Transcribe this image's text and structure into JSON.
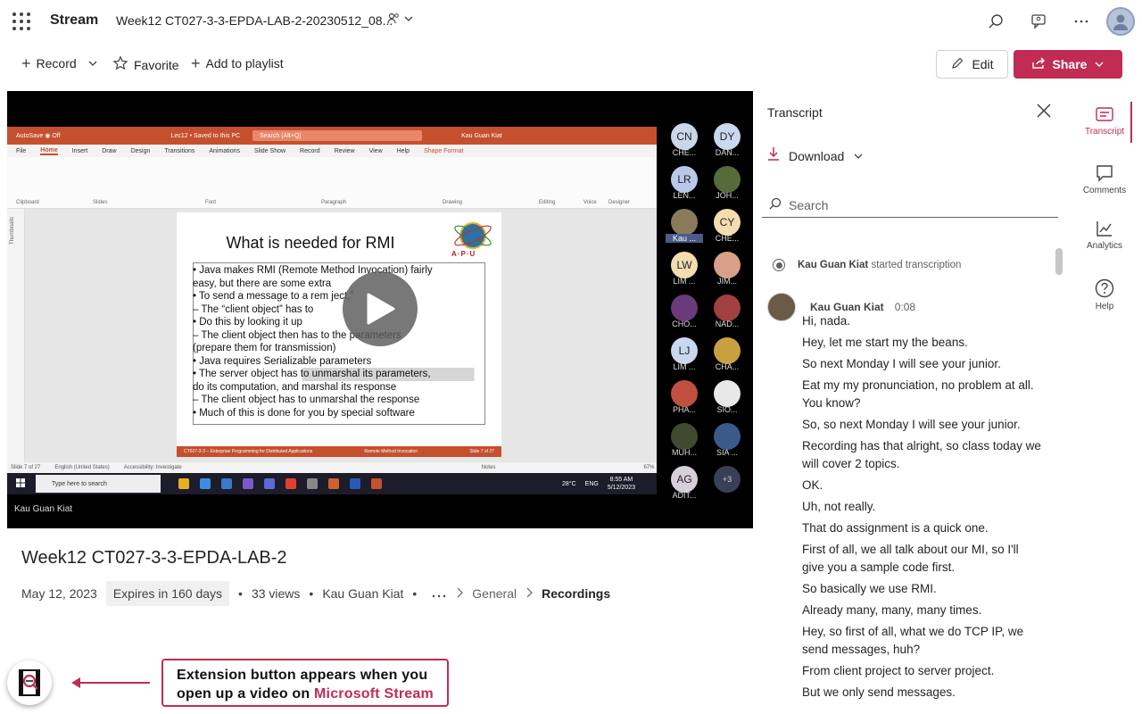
{
  "header": {
    "app_name": "Stream",
    "doc_title": "Week12 CT027-3-3-EPDA-LAB-2-20230512_08..."
  },
  "commands": {
    "record": "Record",
    "favorite": "Favorite",
    "add_to_playlist": "Add to playlist",
    "edit": "Edit",
    "share": "Share"
  },
  "video": {
    "presenter_name": "Kau Guan Kiat",
    "slide": {
      "title": "What is needed for RMI",
      "logo_text": "A·P·U",
      "lines": [
        "•  Java makes RMI (Remote Method Invocation) fairly",
        "    easy, but there are some extra",
        "•  To send a message to a rem              ject,”",
        "    –  The “client object” has to",
        "          •  Do this by looking it up",
        "    –  The client object then has to              the parameters",
        "        (prepare them for transmission)",
        "          •  Java requires Serializable parameters",
        "          •  The server object has to unmarshal its parameters,",
        "              do its computation, and marshal its response",
        "    –  The client object has to unmarshal the response",
        "•  Much of this is done for you by special software"
      ],
      "footer_left": "CT027-3-3 – Enterprise Programming for Distributed Applications",
      "footer_mid": "Remote Method Invocation",
      "footer_right": "Slide 7 of 27"
    },
    "powerpoint": {
      "title": "Lec12 • Saved to this PC",
      "search": "Search (Alt+Q)",
      "user": "Kau Guan Kiat",
      "tabs": [
        "File",
        "Home",
        "Insert",
        "Draw",
        "Design",
        "Transitions",
        "Animations",
        "Slide Show",
        "Record",
        "Review",
        "View",
        "Help",
        "Shape Format"
      ],
      "groups": [
        "Clipboard",
        "Slides",
        "Font",
        "Paragraph",
        "Drawing",
        "Editing",
        "Voice",
        "Designer"
      ],
      "status_slide": "Slide 7 of 27",
      "status_lang": "English (United States)",
      "status_access": "Accessibility: Investigate",
      "status_notes": "Notes",
      "status_zoom": "67%"
    },
    "taskbar": {
      "search": "Type here to search",
      "weather": "28°C",
      "lang": "ENG",
      "time": "8:55 AM",
      "date": "5/12/2023"
    },
    "participants": [
      {
        "initials": "CN",
        "name": "CHE...",
        "color": "#c8d8e8"
      },
      {
        "initials": "DY",
        "name": "DAN...",
        "color": "#c8d8ee"
      },
      {
        "initials": "LR",
        "name": "LEN...",
        "color": "#b8c8e8"
      },
      {
        "initials": "",
        "name": "JOH...",
        "color": "#556b3a"
      },
      {
        "initials": "",
        "name": "Kau ...",
        "color": "#8a7a5a"
      },
      {
        "initials": "CY",
        "name": "CHE...",
        "color": "#f2dcb0"
      },
      {
        "initials": "LW",
        "name": "LIM ...",
        "color": "#f2dcb0"
      },
      {
        "initials": "",
        "name": "JIM...",
        "color": "#d8a088"
      },
      {
        "initials": "",
        "name": "CHO...",
        "color": "#6a3a7a"
      },
      {
        "initials": "",
        "name": "NAD...",
        "color": "#a04040"
      },
      {
        "initials": "LJ",
        "name": "LIM ...",
        "color": "#c8d8ee"
      },
      {
        "initials": "",
        "name": "CHA...",
        "color": "#c8a040"
      },
      {
        "initials": "",
        "name": "PHA...",
        "color": "#c05040"
      },
      {
        "initials": "",
        "name": "SIO...",
        "color": "#e8e8e8"
      },
      {
        "initials": "",
        "name": "MUH...",
        "color": "#404a30"
      },
      {
        "initials": "",
        "name": "SIA ...",
        "color": "#3a5a8a"
      },
      {
        "initials": "AG",
        "name": "ADIT...",
        "color": "#d8d0d8"
      },
      {
        "initials": "+3",
        "name": "",
        "color": "#3a3f58"
      }
    ]
  },
  "details": {
    "title": "Week12 CT027-3-3-EPDA-LAB-2",
    "date": "May 12, 2023",
    "expires": "Expires in 160 days",
    "views": "33 views",
    "owner": "Kau Guan Kiat",
    "crumb_1": "General",
    "crumb_2": "Recordings"
  },
  "extension": {
    "callout_line1": "Extension button appears when you",
    "callout_line2_prefix": "open up a video on ",
    "callout_line2_highlight": "Microsoft Stream"
  },
  "transcript": {
    "title": "Transcript",
    "download": "Download",
    "search_placeholder": "Search",
    "started_name": "Kau Guan Kiat",
    "started_text": "started transcription",
    "speaker": "Kau Guan Kiat",
    "speaker_time": "0:08",
    "lines": [
      "Hi, nada.",
      "Hey, let me start my the beans.",
      "So next Monday I will see your junior.",
      "Eat my my pronunciation, no problem at all. You know?",
      "So, so next Monday I will see your junior.",
      "Recording has that alright, so class today we will cover 2 topics.",
      "OK.",
      "Uh, not really.",
      "That do assignment is a quick one.",
      "First of all, we all talk about our MI, so I'll give you a sample code first.",
      "So basically we use RMI.",
      "Already many, many, many times.",
      "Hey, so first of all, what we do TCP IP, we send messages, huh?",
      "From client project to server project.",
      "But we only send messages."
    ]
  },
  "rail": {
    "transcript": "Transcript",
    "comments": "Comments",
    "analytics": "Analytics",
    "help": "Help"
  },
  "colors": {
    "brand": "#c02c53",
    "ppt_orange": "#c5502e"
  }
}
